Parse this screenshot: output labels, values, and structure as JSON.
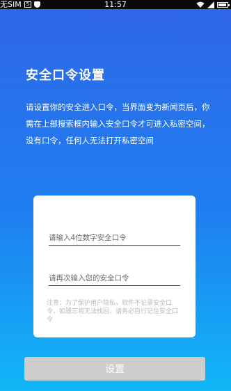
{
  "status_bar": {
    "carrier": "无SIM",
    "box_icon_glyph": "S",
    "time": "11:57"
  },
  "page": {
    "title": "安全口令设置",
    "description": "请设置你的安全进入口令，当界面变为新闻页后，你需在上部搜索框内输入安全口令才可进入私密空间，没有口令，任何人无法打开私密空间"
  },
  "form": {
    "passcode_placeholder": "请输入4位数字安全口令",
    "confirm_placeholder": "请再次输入您的安全口令",
    "note": "注意：为了保护用户隐私，软件不记录安全口令，如遗忘将无法找回，请务必自行记住安全口令",
    "submit_label": "设置"
  },
  "colors": {
    "gradient_top": "#2f66e6",
    "gradient_bottom": "#11b7f7",
    "button_disabled": "#cdcdcd"
  }
}
